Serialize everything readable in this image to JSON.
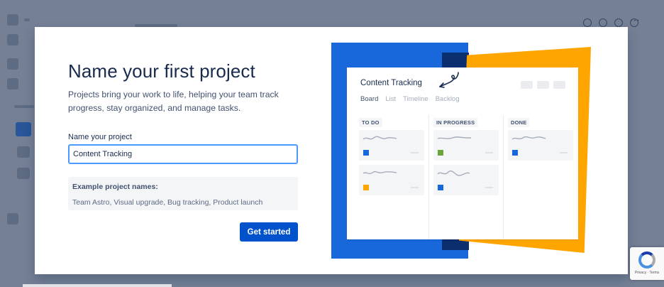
{
  "modal": {
    "title": "Name your first project",
    "subtitle": "Projects bring your work to life, helping your team track progress, stay organized, and manage tasks.",
    "field_label": "Name your project",
    "field_value": "Content Tracking",
    "examples_title": "Example project names:",
    "examples_list": "Team Astro, Visual upgrade, Bug tracking, Product launch",
    "primary_button": "Get started"
  },
  "illustration": {
    "board_title": "Content Tracking",
    "tabs": [
      "Board",
      "List",
      "Timeline",
      "Backlog"
    ],
    "active_tab": "Board",
    "columns": [
      "TO DO",
      "IN PROGRESS",
      "DONE"
    ],
    "colors": {
      "blue": "#1868db",
      "navy": "#0a2e6e",
      "yellow": "#ffa500",
      "card_blue": "#1868db",
      "card_green": "#6aa53a",
      "card_orange": "#ffa500"
    }
  },
  "colors": {
    "primary_button": "#0052cc",
    "input_focus_border": "#4c9aff",
    "title_text": "#172b4d"
  }
}
